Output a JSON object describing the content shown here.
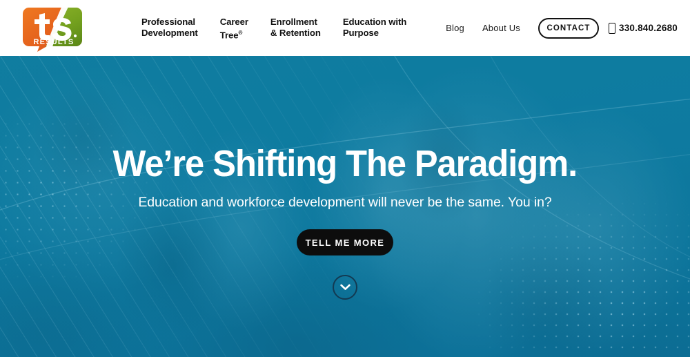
{
  "brand": {
    "logo_primary_text": "tfs",
    "logo_secondary_text": "RESULTS",
    "logo_orange": "#e8641e",
    "logo_green": "#7aa720",
    "logo_name": "tfs-results-logo"
  },
  "header": {
    "primary_nav": [
      {
        "label": "Professional\nDevelopment",
        "name": "nav-professional-development"
      },
      {
        "label": "Career\nTree",
        "suffix": "®",
        "name": "nav-career-tree"
      },
      {
        "label": "Enrollment\n& Retention",
        "name": "nav-enrollment-retention"
      },
      {
        "label": "Education with\nPurpose",
        "name": "nav-education-with-purpose"
      }
    ],
    "secondary_nav": [
      {
        "label": "Blog",
        "name": "nav-blog"
      },
      {
        "label": "About Us",
        "name": "nav-about-us"
      }
    ],
    "contact_button": "CONTACT",
    "phone_icon": "mobile-phone-icon",
    "phone_number": "330.840.2680"
  },
  "hero": {
    "title": "We’re Shifting The Paradigm.",
    "subtitle": "Education and workforce development will never be the same. You in?",
    "cta_label": "TELL ME MORE",
    "scroll_icon": "chevron-down-icon",
    "overlay_color": "#0e7ba3",
    "accent_dark": "#133a52"
  }
}
